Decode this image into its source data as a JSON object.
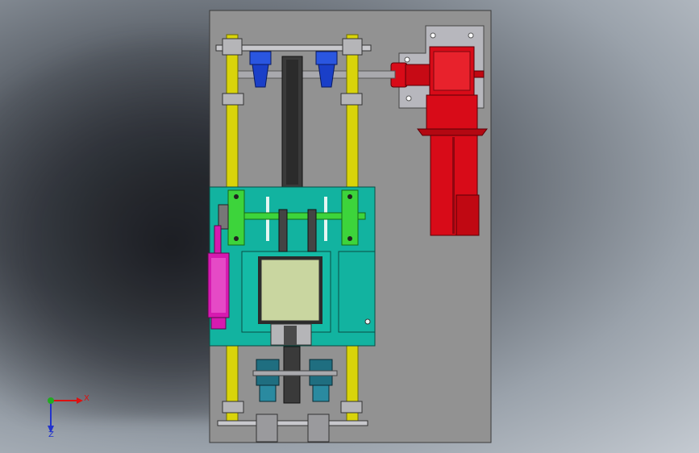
{
  "triad": {
    "x_label": "X",
    "z_label": "Z"
  },
  "colors": {
    "base_plate": "#929292",
    "rail": "#d9d40a",
    "motor": "#d80b18",
    "carriage": "#12b3a0",
    "shaft": "#3dd43b",
    "cylinder": "#d61ab0",
    "belt": "#3a3a3a",
    "bearing_blue": "#1a3fc8",
    "bearing_teal": "#1f6e80",
    "window": "#c9d6a0"
  }
}
